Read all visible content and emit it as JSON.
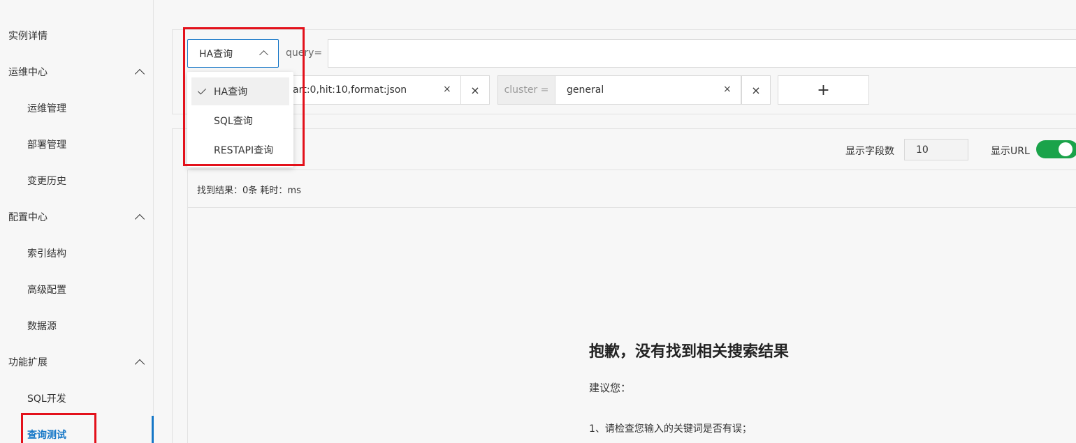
{
  "sidebar": {
    "items": [
      {
        "label": "实例详情",
        "type": "link"
      },
      {
        "label": "运维中心",
        "type": "group"
      },
      {
        "label": "运维管理",
        "type": "sub"
      },
      {
        "label": "部署管理",
        "type": "sub"
      },
      {
        "label": "变更历史",
        "type": "sub"
      },
      {
        "label": "配置中心",
        "type": "group"
      },
      {
        "label": "索引结构",
        "type": "sub"
      },
      {
        "label": "高级配置",
        "type": "sub"
      },
      {
        "label": "数据源",
        "type": "sub"
      },
      {
        "label": "功能扩展",
        "type": "group"
      },
      {
        "label": "SQL开发",
        "type": "sub"
      },
      {
        "label": "查询测试",
        "type": "sub",
        "active": true
      }
    ],
    "accent_color": "#1677c7"
  },
  "query": {
    "type_selected": "HA查询",
    "type_options": [
      "HA查询",
      "SQL查询",
      "RESTAPI查询"
    ],
    "query_label": "query=",
    "query_value": "",
    "param_value": "art:0,hit:10,format:json",
    "cluster_label": "cluster =",
    "cluster_value": "general",
    "clear_glyph": "×",
    "remove_glyph": "×",
    "add_glyph": "+"
  },
  "results": {
    "field_count_label": "显示字段数",
    "field_count_value": "10",
    "show_url_label": "显示URL",
    "show_url_on": true,
    "stats": "找到结果：0条  耗时：ms",
    "empty_title": "抱歉，没有找到相关搜索结果",
    "empty_suggest": "建议您：",
    "empty_tip1": "1、请检查您输入的关键词是否有误；"
  },
  "colors": {
    "highlight_red": "#e3111b",
    "toggle_green": "#1aa34a"
  }
}
